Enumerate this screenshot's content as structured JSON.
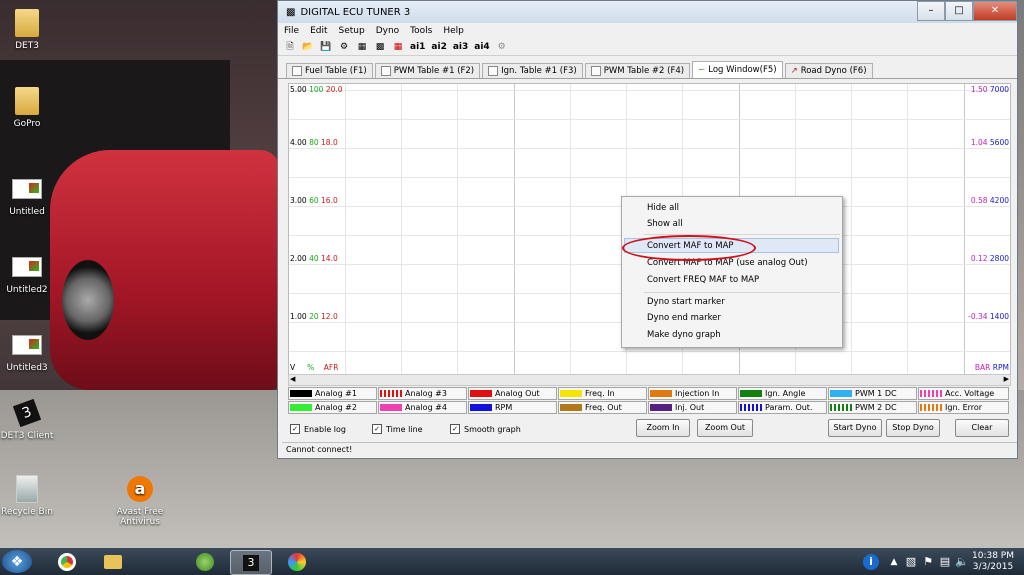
{
  "desktop": {
    "icons": [
      {
        "label": "DET3",
        "glyph": "folder-icon"
      },
      {
        "label": "GoPro",
        "glyph": "folder-icon"
      },
      {
        "label": "Untitled",
        "glyph": "app-icon"
      },
      {
        "label": "Untitled2",
        "glyph": "app-icon"
      },
      {
        "label": "Untitled3",
        "glyph": "app-icon"
      },
      {
        "label": "DET3 Client",
        "glyph": "det3-icon"
      },
      {
        "label": "Recycle Bin",
        "glyph": "recycle-bin-icon"
      },
      {
        "label": "Avast Free Antivirus",
        "glyph": "avast-icon"
      }
    ]
  },
  "window": {
    "title": "DIGITAL ECU TUNER 3",
    "menu": [
      "File",
      "Edit",
      "Setup",
      "Dyno",
      "Tools",
      "Help"
    ],
    "toolbar_labels": [
      "ai1",
      "ai2",
      "ai3",
      "ai4"
    ],
    "tabs": [
      {
        "label": "Fuel Table (F1)"
      },
      {
        "label": "PWM Table #1 (F2)"
      },
      {
        "label": "Ign. Table #1 (F3)"
      },
      {
        "label": "PWM Table #2 (F4)"
      },
      {
        "label": "Log Window(F5)"
      },
      {
        "label": "Road Dyno (F6)"
      }
    ],
    "graph": {
      "left_rows": [
        {
          "v": "5.00",
          "a": "100",
          "b": "20.0"
        },
        {
          "v": "4.00",
          "a": "80",
          "b": "18.0"
        },
        {
          "v": "3.00",
          "a": "60",
          "b": "16.0"
        },
        {
          "v": "2.00",
          "a": "40",
          "b": "14.0"
        },
        {
          "v": "1.00",
          "a": "20",
          "b": "12.0"
        }
      ],
      "right_rows": [
        {
          "bar": "1.50",
          "rpm": "7000"
        },
        {
          "bar": "1.04",
          "rpm": "5600"
        },
        {
          "bar": "0.58",
          "rpm": "4200"
        },
        {
          "bar": "0.12",
          "rpm": "2800"
        },
        {
          "bar": "-0.34",
          "rpm": "1400"
        }
      ],
      "bottom_left": {
        "v": "V",
        "pct": "%",
        "afr": "AFR"
      },
      "bottom_right": {
        "bar": "BAR",
        "rpm": "RPM"
      }
    },
    "legend": [
      {
        "label": "Analog #1",
        "color": "#000000"
      },
      {
        "label": "Analog #2",
        "color": "#33ee33"
      },
      {
        "label": "Analog #3",
        "color": "#e01010",
        "striped": true
      },
      {
        "label": "Analog #4",
        "color": "#f040b0"
      },
      {
        "label": "Analog Out",
        "color": "#e01010"
      },
      {
        "label": "RPM",
        "color": "#1010e0"
      },
      {
        "label": "Freq. In",
        "color": "#f4e400"
      },
      {
        "label": "Freq. Out",
        "color": "#b07a18"
      },
      {
        "label": "Injection In",
        "color": "#e07a10"
      },
      {
        "label": "Inj. Out",
        "color": "#552080"
      },
      {
        "label": "Ign. Angle",
        "color": "#108010"
      },
      {
        "label": "Param. Out.",
        "color": "#1010e0",
        "striped": true
      },
      {
        "label": "PWM 1 DC",
        "color": "#30b0f0"
      },
      {
        "label": "PWM 2 DC",
        "color": "#108010",
        "striped": true
      },
      {
        "label": "Acc. Voltage",
        "color": "#f040b0",
        "striped": true
      },
      {
        "label": "Ign. Error",
        "color": "#e07a10",
        "striped": true
      }
    ],
    "checks": [
      {
        "label": "Enable log",
        "checked": "✓"
      },
      {
        "label": "Time line",
        "checked": "✓"
      },
      {
        "label": "Smooth graph",
        "checked": "✓"
      }
    ],
    "buttons": {
      "zoom_in": "Zoom In",
      "zoom_out": "Zoom Out",
      "start_dyno": "Start Dyno",
      "stop_dyno": "Stop Dyno",
      "clear": "Clear"
    },
    "status": "Cannot connect!"
  },
  "context_menu": {
    "items": [
      "Hide all",
      "Show all",
      "Convert MAF to MAP",
      "Convert MAF to MAP (use analog Out)",
      "Convert FREQ MAF to MAP",
      "Dyno start marker",
      "Dyno end marker",
      "Make dyno graph"
    ]
  },
  "taskbar": {
    "time": "10:38 PM",
    "date": "3/3/2015"
  }
}
